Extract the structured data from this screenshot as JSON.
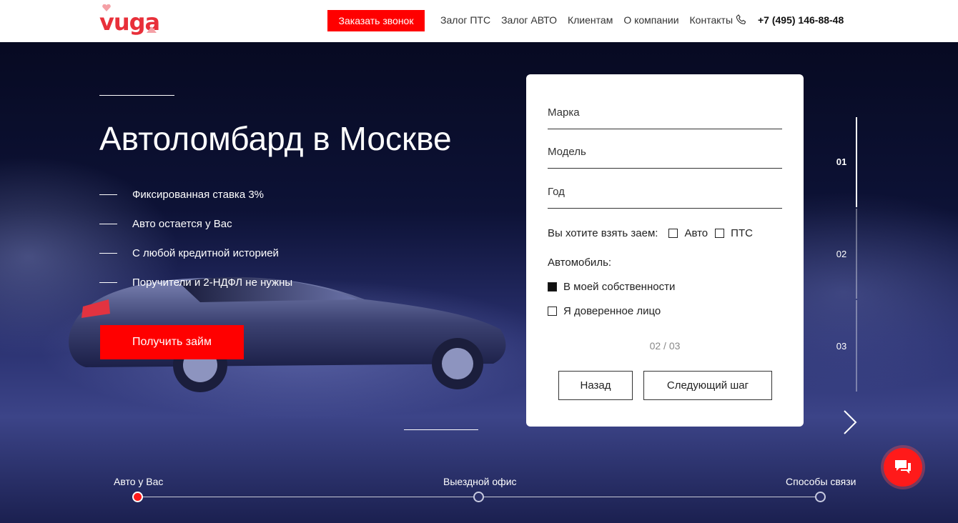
{
  "header": {
    "logo_text": "vuga",
    "call_button": "Заказать звонок",
    "nav": [
      "Залог ПТС",
      "Залог АВТО",
      "Клиентам",
      "О компании",
      "Контакты"
    ],
    "phone": "+7 (495) 146-88-48"
  },
  "hero": {
    "title": "Автоломбард в Москве",
    "features": [
      "Фиксированная ставка 3%",
      "Авто остается у Вас",
      "С любой кредитной историей",
      "Поручители и 2-НДФЛ не нужны"
    ],
    "cta": "Получить займ"
  },
  "form": {
    "fields": [
      "Марка",
      "Модель",
      "Год"
    ],
    "loan_question": "Вы хотите взять заем:",
    "loan_options": [
      {
        "label": "Авто",
        "checked": false
      },
      {
        "label": "ПТС",
        "checked": false
      }
    ],
    "car_title": "Автомобиль:",
    "car_options": [
      {
        "label": "В моей собственности",
        "checked": true
      },
      {
        "label": "Я доверенное лицо",
        "checked": false
      }
    ],
    "step_counter": "02 / 03",
    "back": "Назад",
    "next": "Следующий шаг"
  },
  "steps": [
    "01",
    "02",
    "03"
  ],
  "active_step": 1,
  "timeline": {
    "items": [
      "Авто у Вас",
      "Выездной офис",
      "Способы связи"
    ],
    "active": 1
  },
  "colors": {
    "brand": "#ff0000",
    "logo": "#e8303a"
  },
  "icons": {
    "phone": "phone-icon",
    "chat": "chat-icon",
    "arrow": "chevron-right-icon"
  }
}
